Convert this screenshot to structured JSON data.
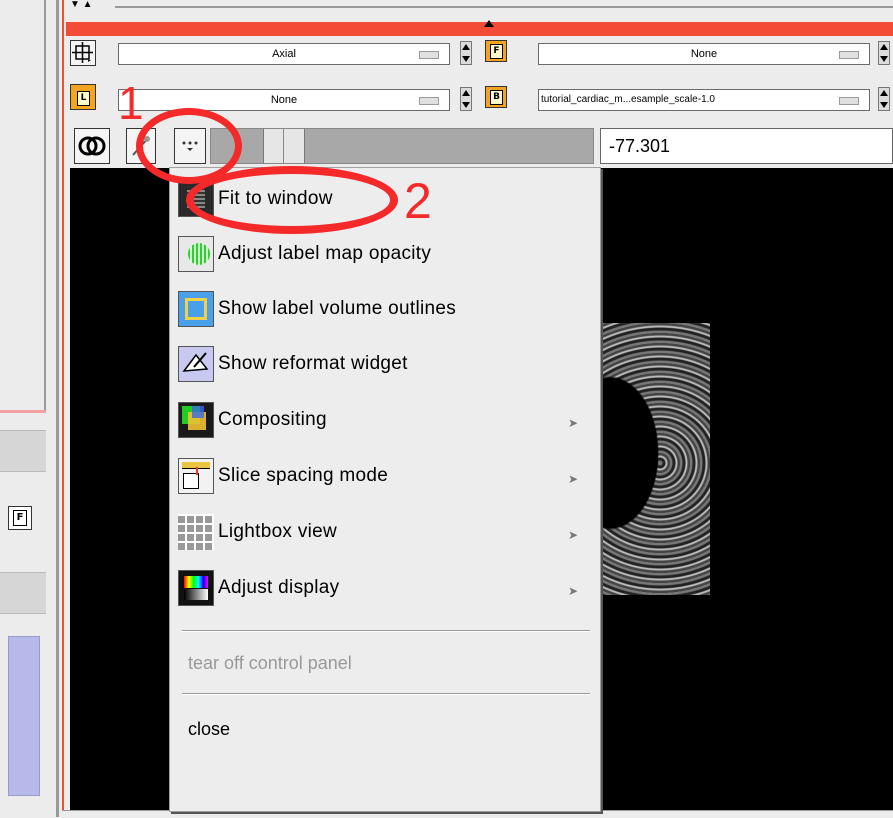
{
  "viewer": {
    "orientation_value": "Axial",
    "foreground_value": "None",
    "label_value": "None",
    "background_value": "tutorial_cardiac_m...esample_scale-1.0",
    "slice_offset_value": "-77.301",
    "foreground_badge": "F",
    "label_badge": "L",
    "background_badge": "B",
    "side_badge": "F"
  },
  "menu": {
    "items": [
      {
        "label": "Fit to window",
        "icon": "fit-window-icon",
        "submenu": false
      },
      {
        "label": "Adjust label map opacity",
        "icon": "label-opacity-icon",
        "submenu": false
      },
      {
        "label": "Show label volume outlines",
        "icon": "label-outlines-icon",
        "submenu": false
      },
      {
        "label": "Show reformat widget",
        "icon": "reformat-widget-icon",
        "submenu": false
      },
      {
        "label": "Compositing",
        "icon": "compositing-icon",
        "submenu": true
      },
      {
        "label": "Slice spacing mode",
        "icon": "slice-spacing-icon",
        "submenu": true
      },
      {
        "label": "Lightbox view",
        "icon": "lightbox-icon",
        "submenu": true
      },
      {
        "label": "Adjust display",
        "icon": "adjust-display-icon",
        "submenu": true
      }
    ],
    "tear_off_label": "tear off control panel",
    "close_label": "close"
  },
  "annotations": {
    "step1": "1",
    "step2": "2"
  },
  "colors": {
    "slice_bar_red": "#f24c37",
    "annotation_red": "#f42a2a",
    "badge_orange": "#f3a522"
  }
}
